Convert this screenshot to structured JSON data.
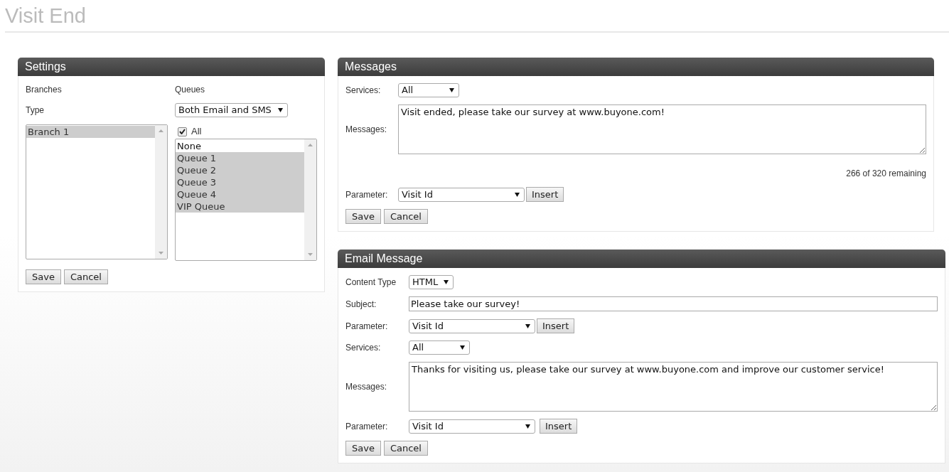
{
  "page_title": "Visit End",
  "settings": {
    "title": "Settings",
    "branches_label": "Branches",
    "queues_label": "Queues",
    "type_label": "Type",
    "type_select": "Both Email and SMS",
    "branches": [
      {
        "label": "Branch 1",
        "selected": true
      }
    ],
    "all_checkbox": {
      "label": "All",
      "checked": true
    },
    "queues": [
      {
        "label": "None",
        "selected": false
      },
      {
        "label": "Queue 1",
        "selected": true
      },
      {
        "label": "Queue 2",
        "selected": true
      },
      {
        "label": "Queue 3",
        "selected": true
      },
      {
        "label": "Queue 4",
        "selected": true
      },
      {
        "label": "VIP Queue",
        "selected": true
      }
    ],
    "buttons": [
      "Save",
      "Cancel"
    ]
  },
  "messages": {
    "title": "Messages",
    "rows": [
      {
        "kind": "select",
        "label": "Services:",
        "value": "All"
      },
      {
        "kind": "textarea",
        "label": "Messages:",
        "value": "Visit ended, please take our survey at www.buyone.com!"
      },
      {
        "kind": "counter",
        "text": "266 of 320 remaining"
      },
      {
        "kind": "parameter",
        "label": "Parameter:",
        "value": "Visit Id",
        "button": "Insert"
      }
    ],
    "buttons": [
      "Save",
      "Cancel"
    ]
  },
  "email_message": {
    "title": "Email Message",
    "rows": [
      {
        "kind": "select",
        "label": "Content Type",
        "value": "HTML"
      },
      {
        "kind": "text",
        "label": "Subject:",
        "value": "Please take our survey!"
      },
      {
        "kind": "parameter",
        "label": "Parameter:",
        "value": "Visit Id",
        "button": "Insert"
      },
      {
        "kind": "select",
        "label": "Services:",
        "value": "All"
      },
      {
        "kind": "textarea",
        "label": "Messages:",
        "value": "Thanks for visiting us, please take our survey at www.buyone.com and improve our customer service!"
      },
      {
        "kind": "parameter",
        "label": "Parameter:",
        "value": "Visit Id",
        "button": "Insert"
      }
    ],
    "buttons": [
      "Save",
      "Cancel"
    ]
  }
}
